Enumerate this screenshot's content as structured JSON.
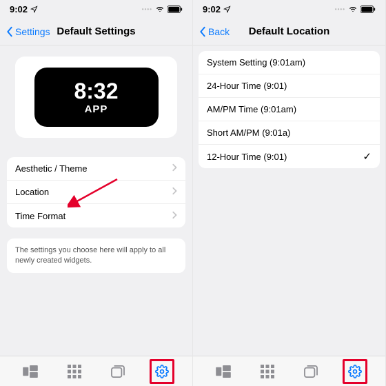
{
  "status": {
    "time": "9:02"
  },
  "left": {
    "back_label": "Settings",
    "title": "Default Settings",
    "widget": {
      "time": "8:32",
      "sub": "APP"
    },
    "rows": {
      "aesthetic": "Aesthetic / Theme",
      "location": "Location",
      "time_format": "Time Format"
    },
    "note": "The settings you choose here will apply to all newly created widgets."
  },
  "right": {
    "back_label": "Back",
    "title": "Default Location",
    "options": {
      "system": "System Setting (9:01am)",
      "h24": "24-Hour Time (9:01)",
      "ampm": "AM/PM Time (9:01am)",
      "short": "Short AM/PM (9:01a)",
      "h12": "12-Hour Time (9:01)"
    }
  }
}
